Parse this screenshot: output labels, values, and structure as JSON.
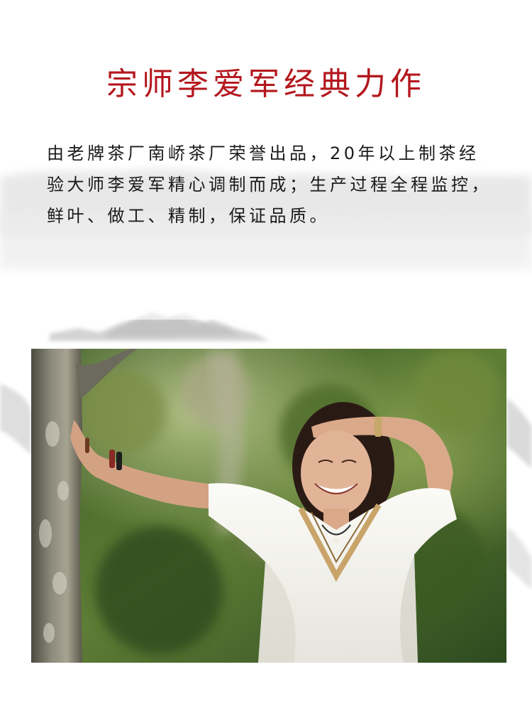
{
  "title": "宗师李爱军经典力作",
  "description": "由老牌茶厂南峤茶厂荣誉出品，20年以上制茶经验大师李爱军精心调制而成；生产过程全程监控，鲜叶、做工、精制，保证品质。",
  "colors": {
    "title_red": "#b3171d",
    "text": "#1a1a1a",
    "ink": "#d8d8d8"
  }
}
